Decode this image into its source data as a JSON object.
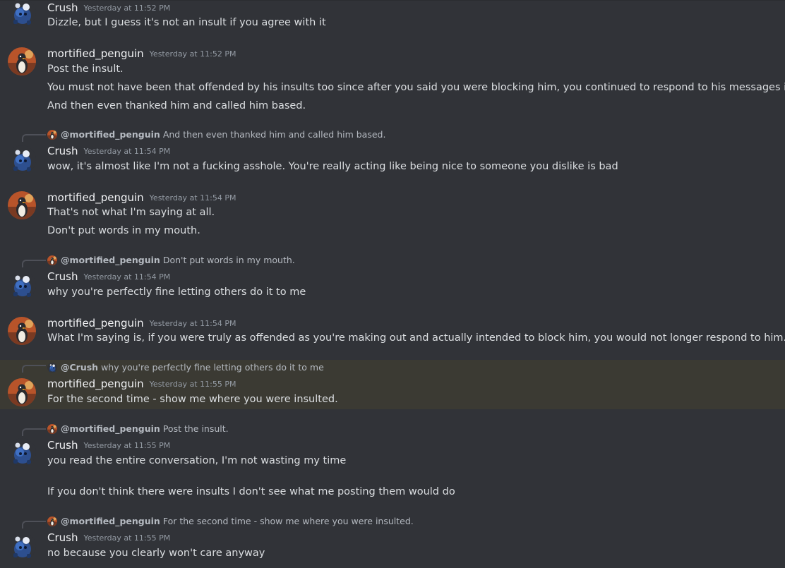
{
  "messages": [
    {
      "author": "Crush",
      "timestamp": "Yesterday at 11:52 PM",
      "lines": [
        "Dizzle, but I guess it's not an insult if you agree with it"
      ]
    },
    {
      "author": "mortified_penguin",
      "timestamp": "Yesterday at 11:52 PM",
      "lines": [
        "Post the insult.",
        "You must not have been that offended by his insults too since after you said you were blocking him, you continued to respond to his messages in the channel",
        "And then even thanked him and called him based."
      ]
    },
    {
      "reply_to": "@mortified_penguin",
      "reply_text": "And then even thanked him and called him based.",
      "author": "Crush",
      "timestamp": "Yesterday at 11:54 PM",
      "lines": [
        "wow, it's almost like I'm not a fucking asshole. You're really acting like being nice to someone you dislike is bad"
      ]
    },
    {
      "author": "mortified_penguin",
      "timestamp": "Yesterday at 11:54 PM",
      "lines": [
        "That's not what I'm saying at all.",
        "Don't put words in my mouth."
      ]
    },
    {
      "reply_to": "@mortified_penguin",
      "reply_text": "Don't put words in my mouth.",
      "author": "Crush",
      "timestamp": "Yesterday at 11:54 PM",
      "lines": [
        "why you're perfectly fine letting others do it to me"
      ]
    },
    {
      "author": "mortified_penguin",
      "timestamp": "Yesterday at 11:54 PM",
      "lines": [
        "What I'm saying is, if you were truly as offended as you're making out and actually intended to block him, you would not longer respond to him."
      ]
    },
    {
      "reply_to": "@Crush",
      "reply_text": "why you're perfectly fine letting others do it to me",
      "author": "mortified_penguin",
      "timestamp": "Yesterday at 11:55 PM",
      "lines": [
        "For the second time - show me where you were insulted."
      ]
    },
    {
      "reply_to": "@mortified_penguin",
      "reply_text": "Post the insult.",
      "author": "Crush",
      "timestamp": "Yesterday at 11:55 PM",
      "lines": [
        "you read the entire conversation, I'm not wasting my time",
        "If you don't think there were insults I don't see  what me posting them would do"
      ]
    },
    {
      "reply_to": "@mortified_penguin",
      "reply_text": "For the second time - show me where you were insulted.",
      "author": "Crush",
      "timestamp": "Yesterday at 11:55 PM",
      "lines": [
        "no because you clearly won't care anyway"
      ]
    }
  ],
  "colors": {
    "background": "#313338",
    "highlight": "#3b3a33",
    "text": "#dbdee1",
    "muted": "#949ba4"
  }
}
